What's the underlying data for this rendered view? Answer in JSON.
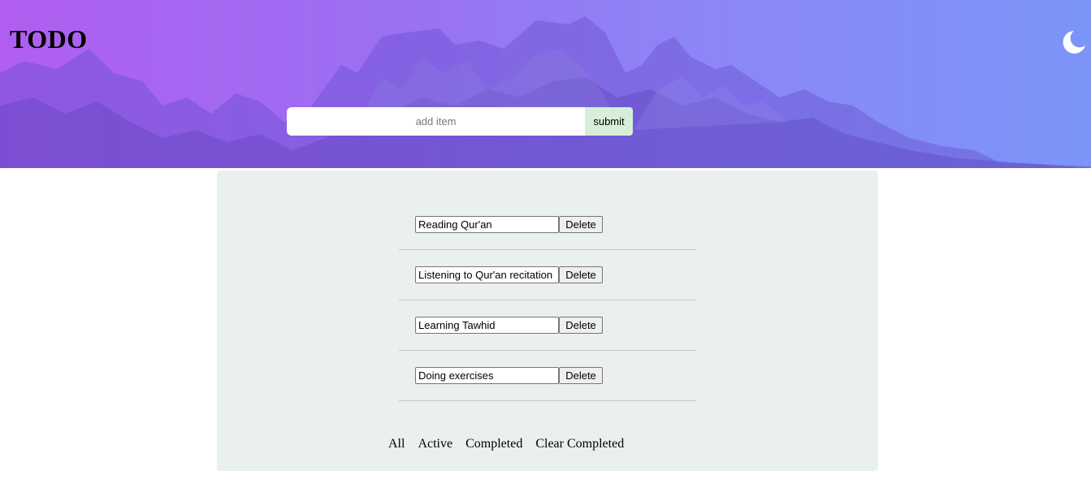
{
  "header": {
    "title": "TODO",
    "theme_icon": "moon-icon"
  },
  "add_form": {
    "placeholder": "add item",
    "value": "",
    "submit_label": "submit"
  },
  "todos": [
    {
      "text": "Reading Qur'an",
      "delete_label": "Delete"
    },
    {
      "text": "Listening to Qur'an recitation",
      "delete_label": "Delete"
    },
    {
      "text": "Learning Tawhid",
      "delete_label": "Delete"
    },
    {
      "text": "Doing exercises",
      "delete_label": "Delete"
    }
  ],
  "filters": {
    "all": "All",
    "active": "Active",
    "completed": "Completed",
    "clear_completed": "Clear Completed"
  },
  "colors": {
    "header_gradient_start": "#b05ef0",
    "header_gradient_end": "#7b95f8",
    "panel_bg": "#eaeff0",
    "submit_bg": "#d7efd9"
  }
}
